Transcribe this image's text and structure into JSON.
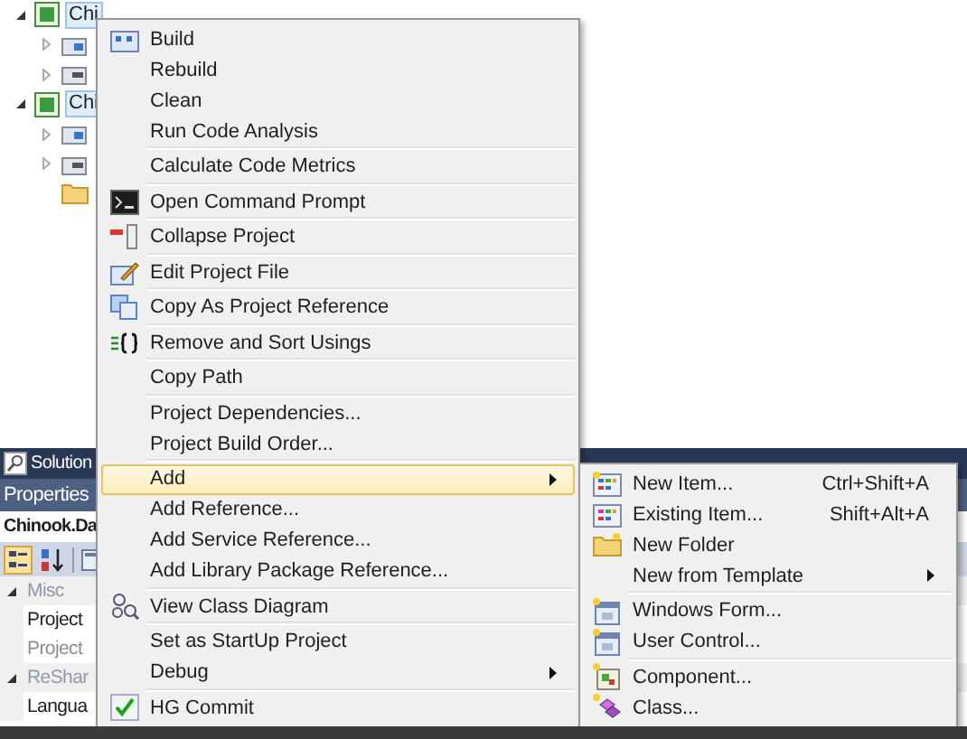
{
  "solution_tree": [
    {
      "label": "Chi",
      "expanded": true,
      "children": [
        {
          "kind": "properties",
          "expanded": false
        },
        {
          "kind": "references",
          "expanded": false
        }
      ]
    },
    {
      "label": "Chi",
      "expanded": true,
      "children": [
        {
          "kind": "properties",
          "expanded": false
        },
        {
          "kind": "references",
          "expanded": false
        },
        {
          "kind": "folder"
        }
      ]
    }
  ],
  "properties_panel": {
    "tab": "Solution",
    "title": "Properties",
    "object": "Chinook.Da",
    "categories": [
      {
        "label": "Misc",
        "expanded": true,
        "rows": [
          {
            "name": "Project",
            "disabled": false
          },
          {
            "name": "Project",
            "disabled": true
          }
        ]
      },
      {
        "label": "ReShar",
        "expanded": true,
        "rows": [
          {
            "name": "Langua",
            "disabled": false
          }
        ]
      }
    ]
  },
  "context_menu": [
    {
      "kind": "item",
      "label": "Build",
      "submenu": false,
      "selected": false
    },
    {
      "kind": "item",
      "label": "Rebuild",
      "submenu": false,
      "selected": false
    },
    {
      "kind": "item",
      "label": "Clean",
      "submenu": false,
      "selected": false
    },
    {
      "kind": "item",
      "label": "Run Code Analysis",
      "submenu": false,
      "selected": false
    },
    {
      "kind": "separator"
    },
    {
      "kind": "item",
      "label": "Calculate Code Metrics",
      "submenu": false,
      "selected": false
    },
    {
      "kind": "separator"
    },
    {
      "kind": "item",
      "label": "Open Command Prompt",
      "submenu": false,
      "selected": false
    },
    {
      "kind": "separator"
    },
    {
      "kind": "item",
      "label": "Collapse Project",
      "submenu": false,
      "selected": false
    },
    {
      "kind": "separator"
    },
    {
      "kind": "item",
      "label": "Edit Project File",
      "submenu": false,
      "selected": false
    },
    {
      "kind": "separator"
    },
    {
      "kind": "item",
      "label": "Copy As Project Reference",
      "submenu": false,
      "selected": false
    },
    {
      "kind": "separator"
    },
    {
      "kind": "item",
      "label": "Remove and Sort Usings",
      "submenu": false,
      "selected": false
    },
    {
      "kind": "separator"
    },
    {
      "kind": "item",
      "label": "Copy Path",
      "submenu": false,
      "selected": false
    },
    {
      "kind": "separator"
    },
    {
      "kind": "item",
      "label": "Project Dependencies...",
      "submenu": false,
      "selected": false
    },
    {
      "kind": "item",
      "label": "Project Build Order...",
      "submenu": false,
      "selected": false
    },
    {
      "kind": "separator"
    },
    {
      "kind": "item",
      "label": "Add",
      "submenu": true,
      "selected": true
    },
    {
      "kind": "item",
      "label": "Add Reference...",
      "submenu": false,
      "selected": false
    },
    {
      "kind": "item",
      "label": "Add Service Reference...",
      "submenu": false,
      "selected": false
    },
    {
      "kind": "item",
      "label": "Add Library Package Reference...",
      "submenu": false,
      "selected": false
    },
    {
      "kind": "separator"
    },
    {
      "kind": "item",
      "label": "View Class Diagram",
      "submenu": false,
      "selected": false
    },
    {
      "kind": "separator"
    },
    {
      "kind": "item",
      "label": "Set as StartUp Project",
      "submenu": false,
      "selected": false
    },
    {
      "kind": "item",
      "label": "Debug",
      "submenu": true,
      "selected": false
    },
    {
      "kind": "separator"
    },
    {
      "kind": "item",
      "label": "HG Commit",
      "submenu": false,
      "selected": false
    }
  ],
  "add_submenu": [
    {
      "kind": "item",
      "label": "New Item...",
      "shortcut": "Ctrl+Shift+A",
      "submenu": false
    },
    {
      "kind": "item",
      "label": "Existing Item...",
      "shortcut": "Shift+Alt+A",
      "submenu": false
    },
    {
      "kind": "item",
      "label": "New Folder",
      "submenu": false
    },
    {
      "kind": "item",
      "label": "New from Template",
      "submenu": true
    },
    {
      "kind": "separator"
    },
    {
      "kind": "item",
      "label": "Windows Form...",
      "submenu": false
    },
    {
      "kind": "item",
      "label": "User Control...",
      "submenu": false
    },
    {
      "kind": "separator"
    },
    {
      "kind": "item",
      "label": "Component...",
      "submenu": false
    },
    {
      "kind": "item",
      "label": "Class...",
      "submenu": false
    }
  ]
}
